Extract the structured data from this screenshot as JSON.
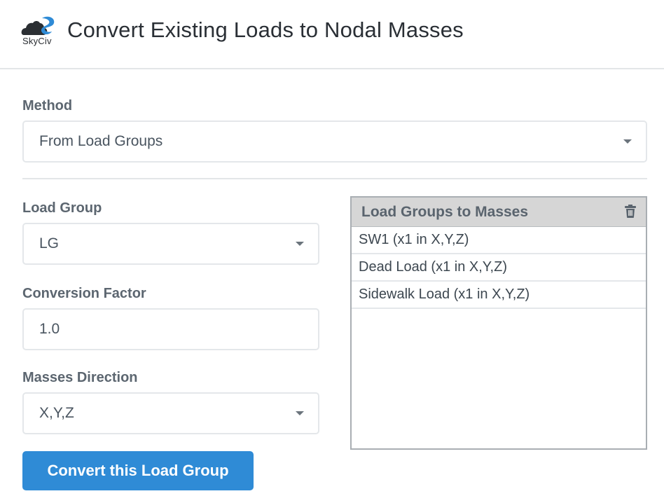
{
  "header": {
    "logo_text": "SkyCiv",
    "title": "Convert Existing Loads to Nodal Masses"
  },
  "method": {
    "label": "Method",
    "value": "From Load Groups"
  },
  "load_group": {
    "label": "Load Group",
    "value": "LG"
  },
  "conversion_factor": {
    "label": "Conversion Factor",
    "value": "1.0"
  },
  "masses_direction": {
    "label": "Masses Direction",
    "value": "X,Y,Z"
  },
  "panel": {
    "title": "Load Groups to Masses",
    "items": [
      "SW1 (x1 in X,Y,Z)",
      "Dead Load (x1 in X,Y,Z)",
      "Sidewalk Load (x1 in X,Y,Z)"
    ]
  },
  "actions": {
    "convert_label": "Convert this Load Group"
  },
  "colors": {
    "accent": "#2f8bd6",
    "logo_blue": "#2f8bd6",
    "logo_dark": "#2b2f33"
  },
  "icons": {
    "logo": "skyciv-logo-icon",
    "delete": "trash-icon",
    "dropdown": "caret-down-icon"
  }
}
